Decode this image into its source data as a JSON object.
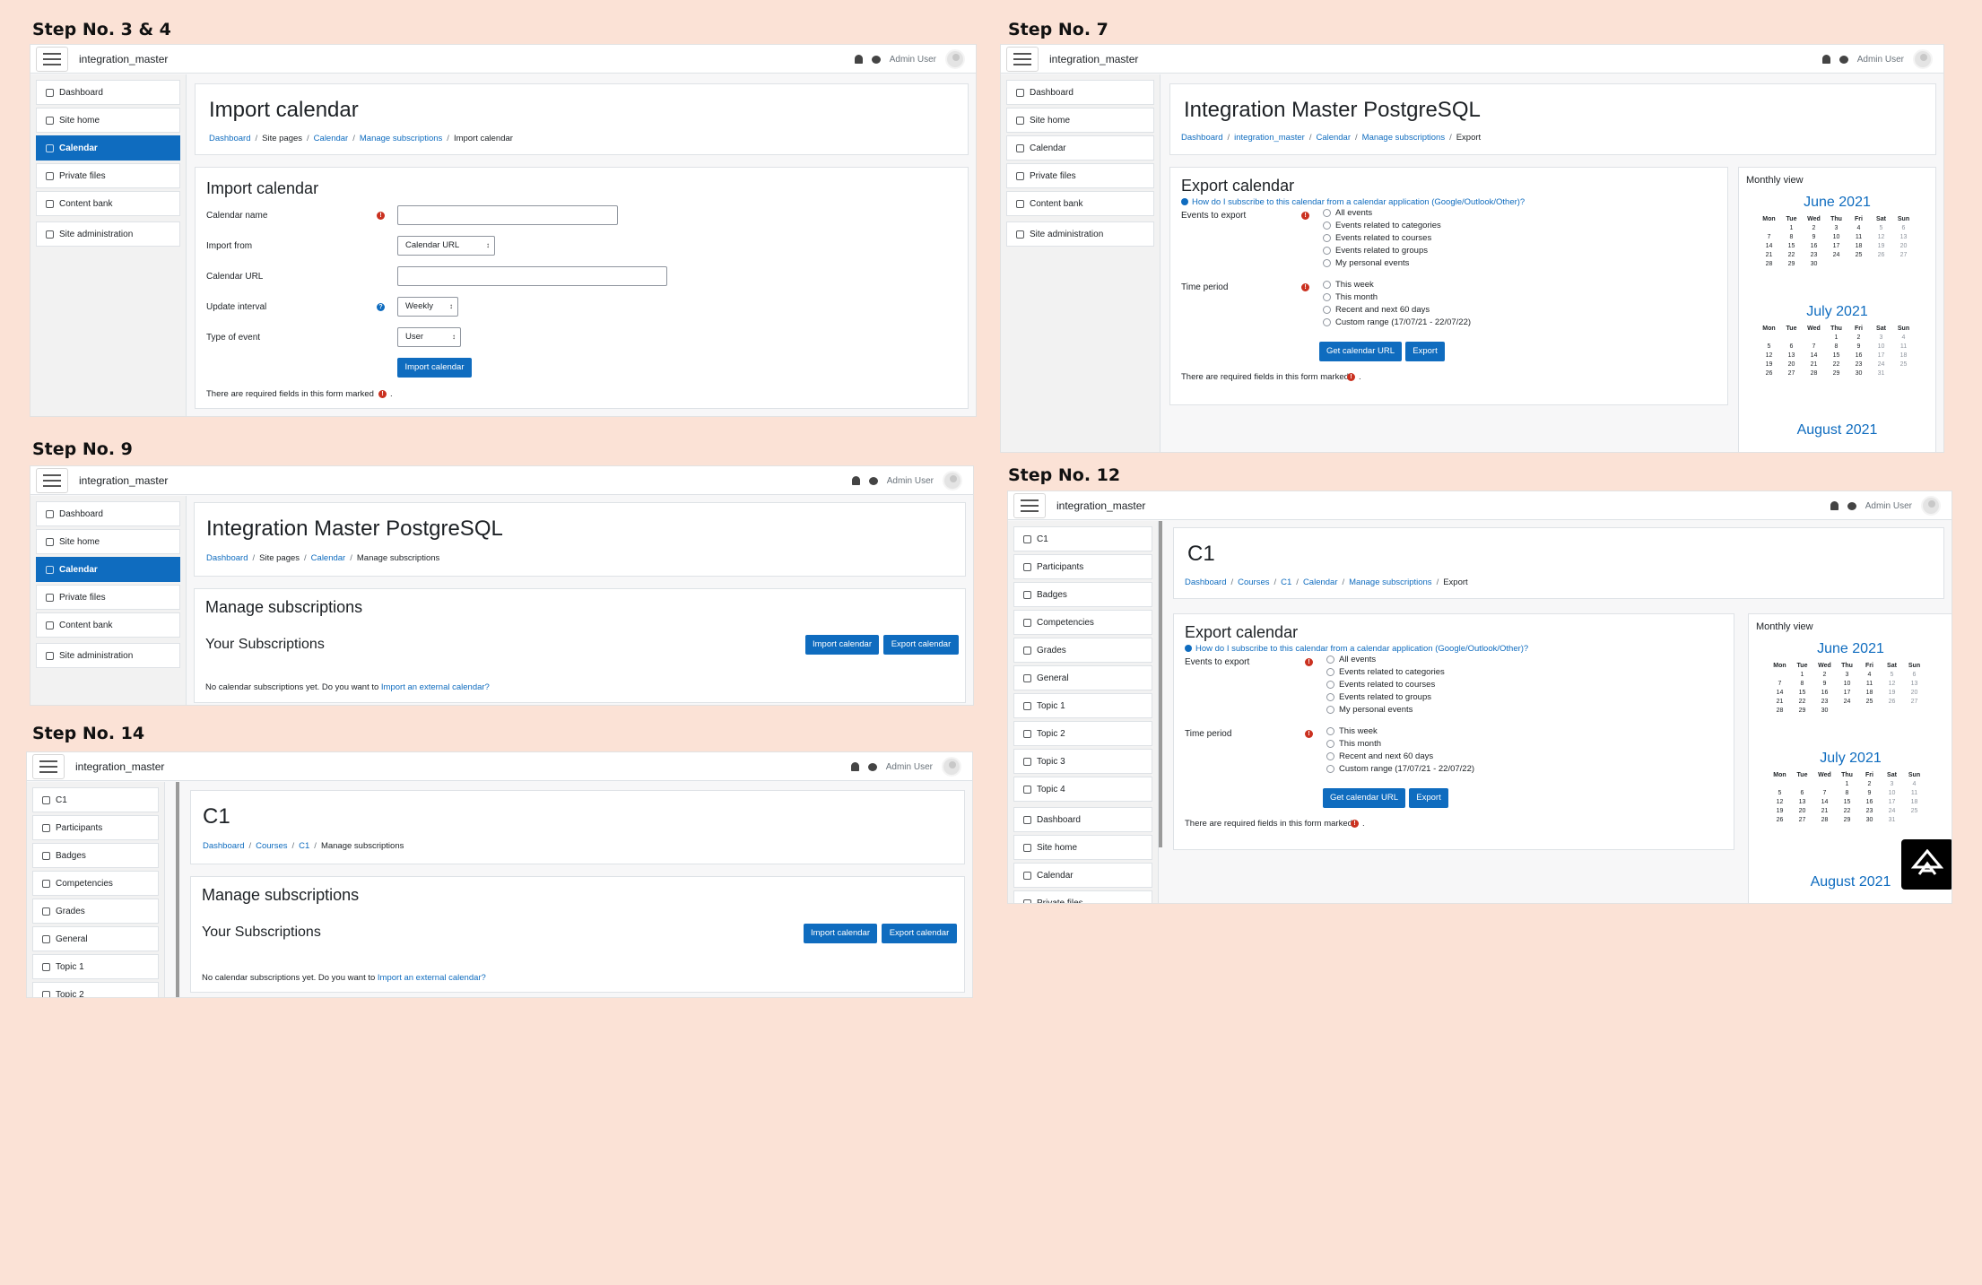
{
  "step_labels": {
    "s1": "Step No. 3 & 4",
    "s2": "Step No. 7",
    "s3": "Step No. 9",
    "s4": "Step No. 12",
    "s5": "Step No. 14"
  },
  "common": {
    "site_name": "integration_master",
    "user_name": "Admin User"
  },
  "nav": {
    "dashboard": "Dashboard",
    "site_home": "Site home",
    "calendar": "Calendar",
    "private_files": "Private files",
    "content_bank": "Content bank",
    "site_admin": "Site administration",
    "c1": "C1",
    "participants": "Participants",
    "badges": "Badges",
    "competencies": "Competencies",
    "grades": "Grades",
    "general": "General",
    "topic1": "Topic 1",
    "topic2": "Topic 2",
    "topic3": "Topic 3",
    "topic4": "Topic 4"
  },
  "breadcrumb": {
    "dashboard": "Dashboard",
    "site_pages": "Site pages",
    "calendar": "Calendar",
    "manage_subscriptions": "Manage subscriptions",
    "import_calendar": "Import calendar",
    "integration_master": "integration_master",
    "export": "Export",
    "courses": "Courses",
    "c1": "C1",
    "sep": "/"
  },
  "import_page": {
    "page_title": "Import calendar",
    "form_title": "Import calendar",
    "calendar_name_label": "Calendar name",
    "import_from_label": "Import from",
    "import_from_value": "Calendar URL",
    "calendar_url_label": "Calendar URL",
    "update_interval_label": "Update interval",
    "update_interval_value": "Weekly",
    "type_of_event_label": "Type of event",
    "type_of_event_value": "User",
    "submit": "Import calendar",
    "required_note": "There are required fields in this form marked",
    "required_dot": "."
  },
  "export_page": {
    "page_title": "Integration Master PostgreSQL",
    "course_title": "C1",
    "form_title": "Export calendar",
    "help_link": "How do I subscribe to this calendar from a calendar application (Google/Outlook/Other)?",
    "events_label": "Events to export",
    "events": [
      "All events",
      "Events related to categories",
      "Events related to courses",
      "Events related to groups",
      "My personal events"
    ],
    "period_label": "Time period",
    "periods": [
      "This week",
      "This month",
      "Recent and next 60 days",
      "Custom range (17/07/21 - 22/07/22)"
    ],
    "get_url": "Get calendar URL",
    "export": "Export",
    "required_note": "There are required fields in this form marked",
    "required_dot": "."
  },
  "manage_page": {
    "page_title": "Integration Master PostgreSQL",
    "course_title": "C1",
    "section_title": "Manage subscriptions",
    "sub_title": "Your Subscriptions",
    "import_btn": "Import calendar",
    "export_btn": "Export calendar",
    "empty_text": "No calendar subscriptions yet. Do you want to",
    "empty_link": "Import an external calendar?"
  },
  "calendar": {
    "panel_title": "Monthly view",
    "weekdays": [
      "Mon",
      "Tue",
      "Wed",
      "Thu",
      "Fri",
      "Sat",
      "Sun"
    ],
    "june": {
      "name": "June 2021",
      "weeks": [
        [
          "",
          "1",
          "2",
          "3",
          "4",
          "5",
          "6"
        ],
        [
          "7",
          "8",
          "9",
          "10",
          "11",
          "12",
          "13"
        ],
        [
          "14",
          "15",
          "16",
          "17",
          "18",
          "19",
          "20"
        ],
        [
          "21",
          "22",
          "23",
          "24",
          "25",
          "26",
          "27"
        ],
        [
          "28",
          "29",
          "30",
          "",
          "",
          "",
          ""
        ]
      ]
    },
    "july": {
      "name": "July 2021",
      "weeks": [
        [
          "",
          "",
          "",
          "1",
          "2",
          "3",
          "4"
        ],
        [
          "5",
          "6",
          "7",
          "8",
          "9",
          "10",
          "11"
        ],
        [
          "12",
          "13",
          "14",
          "15",
          "16",
          "17",
          "18"
        ],
        [
          "19",
          "20",
          "21",
          "22",
          "23",
          "24",
          "25"
        ],
        [
          "26",
          "27",
          "28",
          "29",
          "30",
          "31",
          ""
        ]
      ]
    },
    "august": {
      "name": "August 2021"
    }
  },
  "req_glyph": "!",
  "help_glyph": "?"
}
